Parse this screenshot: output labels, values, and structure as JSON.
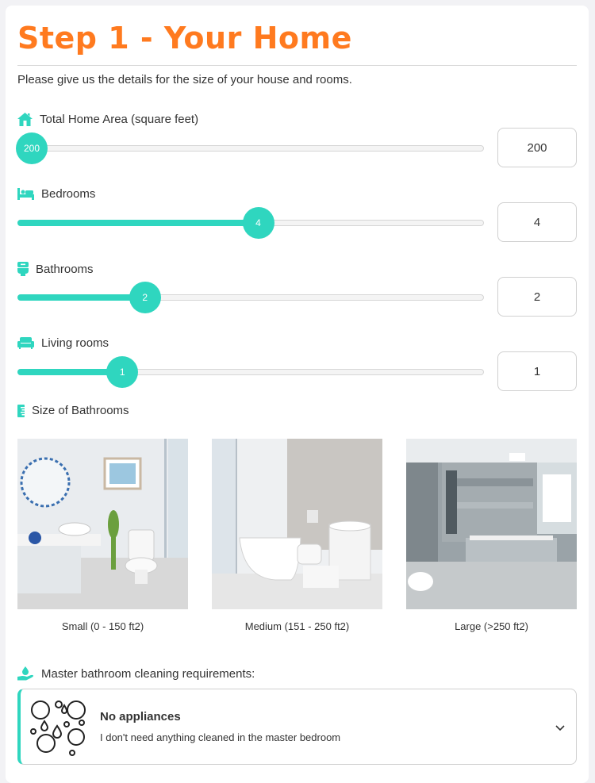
{
  "page": {
    "title": "Step 1 - Your Home",
    "subtitle": "Please give us the details for the size of your house and rooms.",
    "accent_color": "#ff7a1f",
    "slider_color": "#2fd6bf"
  },
  "sliders": [
    {
      "label": "Total Home Area (square feet)",
      "icon": "house-icon",
      "value": "200",
      "fill_fraction": 0.0
    },
    {
      "label": "Bedrooms",
      "icon": "bed-icon",
      "value": "4",
      "fill_fraction": 0.5
    },
    {
      "label": "Bathrooms",
      "icon": "toilet-icon",
      "value": "2",
      "fill_fraction": 0.25
    },
    {
      "label": "Living rooms",
      "icon": "sofa-icon",
      "value": "1",
      "fill_fraction": 0.2
    }
  ],
  "bathroom_size": {
    "label": "Size of Bathrooms",
    "icon": "ruler-icon",
    "options": [
      {
        "caption": "Small (0 - 150 ft2)"
      },
      {
        "caption": "Medium (151 - 250 ft2)"
      },
      {
        "caption": "Large (>250 ft2)"
      }
    ]
  },
  "master_bathroom": {
    "label": "Master bathroom cleaning requirements:",
    "icon": "hand-drop-icon",
    "selected_title": "No appliances",
    "selected_description": "I don't need anything cleaned in the master bedroom",
    "option_icon": "bubbles-icon",
    "chevron_icon": "chevron-down-icon"
  }
}
